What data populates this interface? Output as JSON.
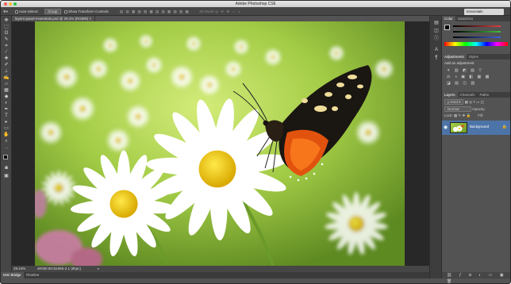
{
  "app": {
    "title": "Adobe Photoshop CS6",
    "workspace": "Essentials"
  },
  "options_bar": {
    "auto_select_label": "Auto-Select:",
    "auto_select_value": "Group",
    "transform_label": "Show Transform Controls",
    "mode_3d": "3D Mode:"
  },
  "document": {
    "tab_label": "layers-panel-essentials.psd @ 29.2% (RGB/8)",
    "zoom": "29.24%",
    "profile": "sRGB IEC61966-2.1 (8bpc)"
  },
  "bottom_tabs": [
    "Mini Bridge",
    "Timeline"
  ],
  "panels": {
    "color_tabs": [
      "Color",
      "Swatches"
    ],
    "adjust_tabs": [
      "Adjustments",
      "Styles"
    ],
    "add_adjustment": "Add an adjustment",
    "layer_tabs": [
      "Layers",
      "Channels",
      "Paths"
    ],
    "kind_label": "Kind",
    "blend_mode": "Normal",
    "opacity_label": "Opacity:",
    "lock_label": "Lock:",
    "fill_label": "Fill:",
    "layer_name": "Background"
  },
  "colors": {
    "accent": "#4d74a8",
    "red": "#e04040",
    "green": "#40c040",
    "blue": "#4060e0"
  }
}
